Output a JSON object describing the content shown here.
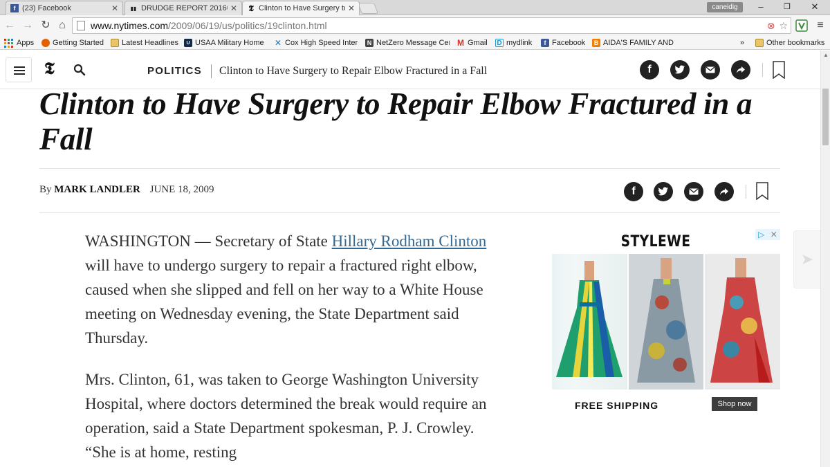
{
  "browser": {
    "tabs": [
      {
        "label": "(23) Facebook",
        "icon": "facebook-icon",
        "active": false
      },
      {
        "label": "DRUDGE REPORT 2016®",
        "icon": "drudge-icon",
        "active": false
      },
      {
        "label": "Clinton to Have Surgery to",
        "icon": "nyt-icon",
        "active": true
      }
    ],
    "profile_name": "caneidig",
    "url_host": "www.nytimes.com",
    "url_path": "/2009/06/19/us/politics/19clinton.html",
    "bookmarks": [
      {
        "label": "Apps",
        "icon": "apps-grid-icon"
      },
      {
        "label": "Getting Started",
        "icon": "firefox-icon"
      },
      {
        "label": "Latest Headlines",
        "icon": "folder-icon"
      },
      {
        "label": "USAA Military Home",
        "icon": "usaa-icon"
      },
      {
        "label": "Cox High Speed Inter",
        "icon": "cox-icon"
      },
      {
        "label": "NetZero Message Cer",
        "icon": "netzero-icon"
      },
      {
        "label": "Gmail",
        "icon": "gmail-icon"
      },
      {
        "label": "mydlink",
        "icon": "dlink-icon"
      },
      {
        "label": "Facebook",
        "icon": "facebook-icon"
      },
      {
        "label": "AIDA'S FAMILY AND F",
        "icon": "blogger-icon"
      }
    ],
    "overflow_chevron": "»",
    "other_bookmarks": "Other bookmarks"
  },
  "nyt": {
    "section": "POLITICS",
    "short_title": "Clinton to Have Surgery to Repair Elbow Fractured in a Fall",
    "headline": "Clinton to Have Surgery to Repair Elbow Fractured in a Fall",
    "byline_prefix": "By",
    "author": "MARK LANDLER",
    "date": "JUNE 18, 2009",
    "paragraph1_before_link": "WASHINGTON — Secretary of State ",
    "paragraph1_link": "Hillary Rodham Clinton",
    "paragraph1_after_link": " will have to undergo surgery to repair a fractured right elbow, caused when she slipped and fell on her way to a White House meeting on Wednesday evening, the State Department said Thursday.",
    "paragraph2": "Mrs. Clinton, 61, was taken to George Washington University Hospital, where doctors determined the break would require an operation, said a State Department spokesman, P. J. Crowley. “She is at home, resting"
  },
  "ad": {
    "brand": "STYLEWE",
    "shipping": "FREE SHIPPING",
    "cta": "Shop now"
  },
  "colors": {
    "link": "#326891",
    "facebook": "#3b5998",
    "gmail": "#d93025",
    "blogger": "#f57d00"
  }
}
